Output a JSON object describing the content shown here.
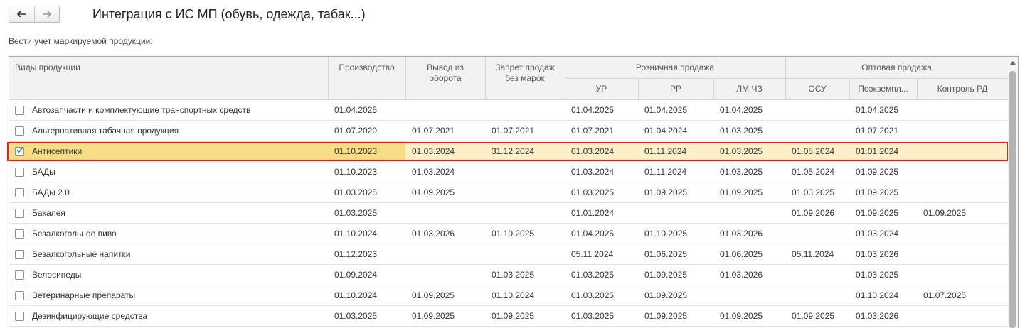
{
  "nav": {
    "back_icon": "arrow-left-icon",
    "forward_icon": "arrow-right-icon"
  },
  "title": "Интеграция с ИС МП (обувь, одежда, табак...)",
  "subtitle": "Вести учет маркируемой продукции:",
  "columns": {
    "type": "Виды продукции",
    "production": "Производство",
    "withdrawal": "Вывод из оборота",
    "ban": "Запрет продаж без марок",
    "retail_group": "Розничная продажа",
    "retail": [
      "УР",
      "РР",
      "ЛМ ЧЗ"
    ],
    "wholesale_group": "Оптовая продажа",
    "wholesale": [
      "ОСУ",
      "Поэкземпл...",
      "Контроль РД"
    ]
  },
  "colors": {
    "selected_row": "#fbf0c7",
    "selected_cell": "#f7de86",
    "highlight_frame": "#e1201c",
    "check": "#2a9d4a"
  },
  "rows": [
    {
      "name": "Автозапчасти и комплектующие транспортных средств",
      "checked": false,
      "values": [
        "01.04.2025",
        "",
        "",
        "01.04.2025",
        "01.04.2025",
        "01.04.2025",
        "",
        "01.04.2025",
        ""
      ]
    },
    {
      "name": "Альтернативная табачная продукция",
      "checked": false,
      "values": [
        "01.07.2020",
        "01.07.2021",
        "01.07.2021",
        "01.07.2021",
        "01.04.2024",
        "01.03.2025",
        "",
        "01.07.2021",
        ""
      ]
    },
    {
      "name": "Антисептики",
      "checked": true,
      "selected": true,
      "values": [
        "01.10.2023",
        "01.03.2024",
        "31.12.2024",
        "01.03.2024",
        "01.11.2024",
        "01.03.2025",
        "01.05.2024",
        "01.01.2024",
        ""
      ]
    },
    {
      "name": "БАДы",
      "checked": false,
      "values": [
        "01.10.2023",
        "01.03.2024",
        "",
        "01.03.2024",
        "01.11.2024",
        "01.03.2025",
        "01.05.2024",
        "01.09.2025",
        ""
      ]
    },
    {
      "name": "БАДы 2.0",
      "checked": false,
      "values": [
        "01.03.2025",
        "01.09.2025",
        "",
        "01.03.2025",
        "01.09.2025",
        "01.09.2025",
        "01.03.2025",
        "01.09.2025",
        ""
      ]
    },
    {
      "name": "Бакалея",
      "checked": false,
      "values": [
        "01.03.2025",
        "",
        "",
        "01.01.2024",
        "",
        "",
        "01.09.2026",
        "01.09.2025",
        "01.09.2025"
      ]
    },
    {
      "name": "Безалкогольное пиво",
      "checked": false,
      "values": [
        "01.10.2024",
        "01.03.2026",
        "01.10.2025",
        "01.04.2025",
        "01.10.2025",
        "01.03.2026",
        "",
        "01.03.2024",
        ""
      ]
    },
    {
      "name": "Безалкогольные напитки",
      "checked": false,
      "values": [
        "01.12.2023",
        "",
        "",
        "05.11.2024",
        "01.06.2025",
        "01.06.2025",
        "05.11.2024",
        "01.03.2026",
        ""
      ]
    },
    {
      "name": "Велосипеды",
      "checked": false,
      "values": [
        "01.09.2024",
        "",
        "01.03.2025",
        "01.03.2025",
        "01.09.2025",
        "01.03.2026",
        "",
        "01.03.2025",
        ""
      ]
    },
    {
      "name": "Ветеринарные препараты",
      "checked": false,
      "values": [
        "01.10.2024",
        "01.09.2025",
        "01.10.2024",
        "01.03.2025",
        "01.09.2025",
        "",
        "",
        "01.10.2024",
        "01.07.2025"
      ]
    },
    {
      "name": "Дезинфицирующие средства",
      "checked": false,
      "values": [
        "01.03.2025",
        "01.09.2025",
        "01.09.2025",
        "01.03.2025",
        "01.09.2025",
        "01.09.2025",
        "01.09.2025",
        "01.03.2026",
        ""
      ]
    }
  ]
}
